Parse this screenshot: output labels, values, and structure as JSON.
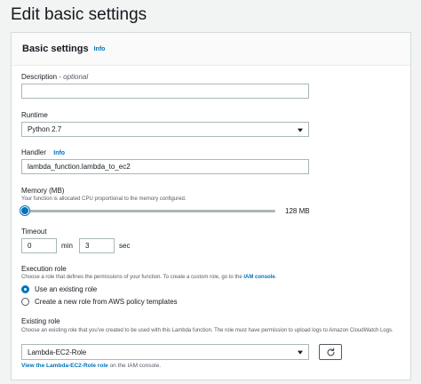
{
  "page": {
    "title": "Edit basic settings"
  },
  "panel": {
    "title": "Basic settings",
    "info": "Info"
  },
  "description": {
    "label": "Description",
    "optional": "- optional",
    "value": ""
  },
  "runtime": {
    "label": "Runtime",
    "value": "Python 2.7"
  },
  "handler": {
    "label": "Handler",
    "info": "Info",
    "value": "lambda_function.lambda_to_ec2"
  },
  "memory": {
    "label": "Memory (MB)",
    "description": "Your function is allocated CPU proportional to the memory configured.",
    "value_text": "128 MB",
    "slider_fraction": 0.0
  },
  "timeout": {
    "label": "Timeout",
    "min_value": "0",
    "min_unit": "min",
    "sec_value": "3",
    "sec_unit": "sec"
  },
  "execution_role": {
    "label": "Execution role",
    "description_prefix": "Choose a role that defines the permissions of your function. To create a custom role, go to the ",
    "description_link": "IAM console",
    "description_suffix": ".",
    "options": [
      {
        "label": "Use an existing role",
        "checked": true
      },
      {
        "label": "Create a new role from AWS policy templates",
        "checked": false
      }
    ]
  },
  "existing_role": {
    "label": "Existing role",
    "description": "Choose an existing role that you've created to be used with this Lambda function. The role must have permission to upload logs to Amazon CloudWatch Logs.",
    "value": "Lambda-EC2-Role",
    "view_link": "View the Lambda-EC2-Role role",
    "view_suffix": " on the IAM console."
  },
  "icons": {
    "refresh": "refresh-icon",
    "caret": "caret-down-icon"
  },
  "colors": {
    "accent": "#0073bb",
    "border": "#aab7b8"
  }
}
